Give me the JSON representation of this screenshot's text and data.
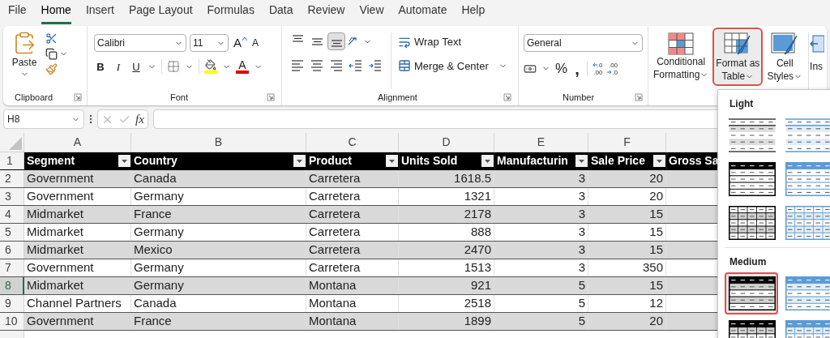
{
  "menu_tabs": [
    {
      "label": "File",
      "selected": false
    },
    {
      "label": "Home",
      "selected": true
    },
    {
      "label": "Insert",
      "selected": false
    },
    {
      "label": "Page Layout",
      "selected": false
    },
    {
      "label": "Formulas",
      "selected": false
    },
    {
      "label": "Data",
      "selected": false
    },
    {
      "label": "Review",
      "selected": false
    },
    {
      "label": "View",
      "selected": false
    },
    {
      "label": "Automate",
      "selected": false
    },
    {
      "label": "Help",
      "selected": false
    }
  ],
  "clipboard": {
    "paste": "Paste",
    "label": "Clipboard"
  },
  "font": {
    "name": "Calibri",
    "size": "11",
    "grow": "A",
    "shrink": "A",
    "label": "Font",
    "style_buttons": [
      {
        "kind": "bold",
        "label": "B"
      },
      {
        "kind": "italic",
        "label": "I"
      },
      {
        "kind": "underline",
        "label": "U"
      }
    ],
    "fill": {
      "color": "#ffff00"
    },
    "font_color": {
      "label": "A",
      "color": "#e00000"
    }
  },
  "alignment": {
    "label": "Alignment",
    "wrap": "Wrap Text",
    "merge": "Merge & Center",
    "vertical": [
      {
        "kind": "top",
        "selected": false
      },
      {
        "kind": "middle",
        "selected": false
      },
      {
        "kind": "bottom",
        "selected": true
      }
    ],
    "horizontal": [
      {
        "kind": "left"
      },
      {
        "kind": "center"
      },
      {
        "kind": "right"
      },
      {
        "kind": "outdent"
      },
      {
        "kind": "indent"
      }
    ]
  },
  "number": {
    "format": "General",
    "percent": "%",
    "comma": ",",
    "label": "Number",
    "decimals": [
      {
        "kind": "increase",
        "top": ".0",
        "bottom": ".00"
      },
      {
        "kind": "decrease",
        "top": ".00",
        "bottom": ".0"
      }
    ]
  },
  "styles": [
    {
      "kind": "conditional",
      "lines": [
        "Conditional",
        "Formatting"
      ],
      "highlighted": false
    },
    {
      "kind": "table",
      "lines": [
        "Format as",
        "Table"
      ],
      "highlighted": true
    },
    {
      "kind": "cell",
      "lines": [
        "Cell",
        "Styles"
      ],
      "highlighted": false
    }
  ],
  "insert_cut": "Ins",
  "name_box": "H8",
  "function_label": "fx",
  "sheet": {
    "columns": [
      {
        "letter": "A",
        "header": "Segment",
        "numeric": false
      },
      {
        "letter": "B",
        "header": "Country",
        "numeric": false
      },
      {
        "letter": "C",
        "header": "Product",
        "numeric": false
      },
      {
        "letter": "D",
        "header": "Units Sold",
        "numeric": true
      },
      {
        "letter": "E",
        "header": "Manufacturin",
        "numeric": true
      },
      {
        "letter": "F",
        "header": "Sale Price",
        "numeric": true
      },
      {
        "header": "Gross Sa",
        "numeric": true
      }
    ],
    "header_row": "1",
    "rows": [
      {
        "number": "2",
        "selected": false,
        "cells": [
          "Government",
          "Canada",
          "Carretera",
          "1618.5",
          "3",
          "20"
        ]
      },
      {
        "number": "3",
        "selected": false,
        "cells": [
          "Government",
          "Germany",
          "Carretera",
          "1321",
          "3",
          "20"
        ]
      },
      {
        "number": "4",
        "selected": false,
        "cells": [
          "Midmarket",
          "France",
          "Carretera",
          "2178",
          "3",
          "15"
        ]
      },
      {
        "number": "5",
        "selected": false,
        "cells": [
          "Midmarket",
          "Germany",
          "Carretera",
          "888",
          "3",
          "15"
        ]
      },
      {
        "number": "6",
        "selected": false,
        "cells": [
          "Midmarket",
          "Mexico",
          "Carretera",
          "2470",
          "3",
          "15"
        ]
      },
      {
        "number": "7",
        "selected": false,
        "cells": [
          "Government",
          "Germany",
          "Carretera",
          "1513",
          "3",
          "350"
        ]
      },
      {
        "number": "8",
        "selected": true,
        "cells": [
          "Midmarket",
          "Germany",
          "Montana",
          "921",
          "5",
          "15"
        ]
      },
      {
        "number": "9",
        "selected": false,
        "cells": [
          "Channel Partners",
          "Canada",
          "Montana",
          "2518",
          "5",
          "12"
        ]
      },
      {
        "number": "10",
        "selected": false,
        "cells": [
          "Government",
          "France",
          "Montana",
          "1899",
          "5",
          "20"
        ]
      }
    ]
  },
  "table_styles": [
    {
      "title": "Light",
      "items": [
        {
          "kind": "banded",
          "color": "#404040",
          "selected": false
        },
        {
          "kind": "banded",
          "color": "#5b9bd5",
          "selected": false
        },
        {
          "kind": "header",
          "color": "#000000",
          "selected": false
        },
        {
          "kind": "header",
          "color": "#5b9bd5",
          "selected": false
        },
        {
          "kind": "grid",
          "color": "#000000",
          "selected": false
        },
        {
          "kind": "grid",
          "color": "#5b9bd5",
          "selected": false
        }
      ]
    },
    {
      "title": "Medium",
      "items": [
        {
          "kind": "header-banded",
          "color": "#000000",
          "selected": true
        },
        {
          "kind": "header-banded",
          "color": "#5b9bd5",
          "selected": false
        },
        {
          "kind": "header-grid",
          "color": "#000000",
          "selected": false
        },
        {
          "kind": "header-grid",
          "color": "#5b9bd5",
          "selected": false
        }
      ]
    }
  ]
}
